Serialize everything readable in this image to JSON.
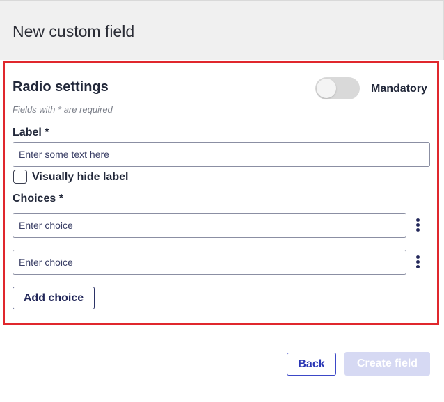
{
  "dialog": {
    "title": "New custom field"
  },
  "form": {
    "section_title": "Radio settings",
    "mandatory_label": "Mandatory",
    "mandatory_on": false,
    "required_note": "Fields with * are required",
    "label_field": {
      "label": "Label *",
      "value": "",
      "placeholder": "Enter some text here"
    },
    "visually_hide": {
      "label": "Visually hide label",
      "checked": false
    },
    "choices": {
      "label": "Choices *",
      "items": [
        {
          "value": "",
          "placeholder": "Enter choice",
          "menu_icon": "kebab-icon"
        },
        {
          "value": "",
          "placeholder": "Enter choice",
          "menu_icon": "kebab-icon"
        }
      ],
      "add_label": "Add choice"
    }
  },
  "footer": {
    "back_label": "Back",
    "create_label": "Create field",
    "create_enabled": false
  },
  "colors": {
    "highlight": "#e0272d",
    "primary": "#2a36b5",
    "disabled_primary": "#d6d9f3"
  }
}
